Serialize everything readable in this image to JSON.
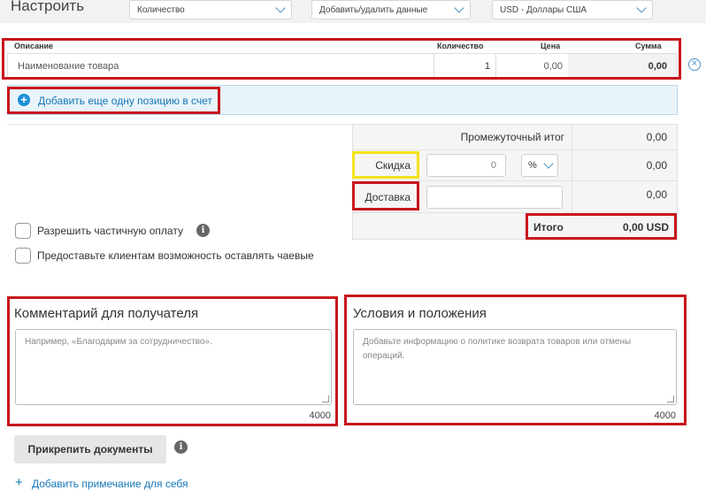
{
  "header": {
    "title": "Настроить",
    "select_quantity": "Количество",
    "select_data": "Добавить/удалить данные",
    "select_currency": "USD - Доллары США"
  },
  "items_table": {
    "columns": [
      "Описание",
      "Количество",
      "Цена",
      "Сумма"
    ],
    "rows": [
      {
        "description": "Наименование товара",
        "quantity": "1",
        "price": "0,00",
        "amount": "0,00"
      }
    ]
  },
  "add_item_label": "Добавить еще одну позицию в счет",
  "totals": {
    "subtotal_label": "Промежуточный итог",
    "subtotal_value": "0,00",
    "discount_label": "Скидка",
    "discount_input": "0",
    "discount_unit": "%",
    "discount_value": "0,00",
    "shipping_label": "Доставка",
    "shipping_value": "0,00",
    "total_label": "Итого",
    "total_value": "0,00 USD"
  },
  "options": {
    "partial_payment": "Разрешить частичную оплату",
    "tips": "Предоставьте клиентам возможность оставлять чаевые"
  },
  "comment": {
    "title": "Комментарий для получателя",
    "placeholder": "Например, «Благодарим за сотрудничество».",
    "counter": "4000"
  },
  "terms": {
    "title": "Условия и положения",
    "placeholder": "Добавьте информацию о политике возврата товаров или отмены операций.",
    "counter": "4000"
  },
  "attach_label": "Прикрепить документы",
  "add_note_label": "Добавить примечание для себя",
  "colors": {
    "highlight_red": "#c8161d",
    "highlight_yellow": "#f4e21a",
    "accent_blue": "#1a8fd6"
  }
}
